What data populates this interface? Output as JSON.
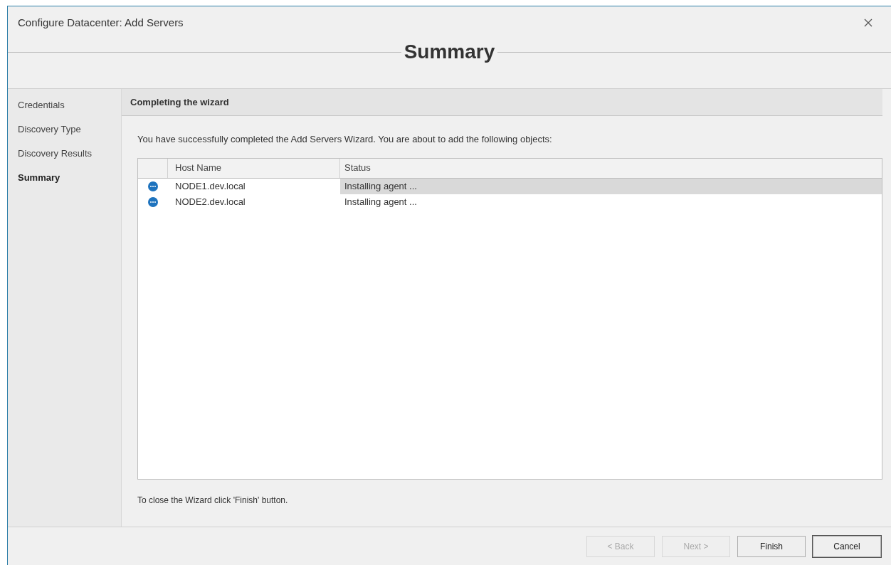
{
  "window": {
    "title": "Configure Datacenter: Add Servers",
    "heading": "Summary"
  },
  "steps": [
    {
      "label": "Credentials",
      "selected": false
    },
    {
      "label": "Discovery Type",
      "selected": false
    },
    {
      "label": "Discovery Results",
      "selected": false
    },
    {
      "label": "Summary",
      "selected": true
    }
  ],
  "panel": {
    "title": "Completing the wizard",
    "intro": "You have successfully completed the Add Servers Wizard. You are about to add the following objects:",
    "footnote": "To close the Wizard click 'Finish' button."
  },
  "table": {
    "columns": [
      "Host Name",
      "Status"
    ],
    "rows": [
      {
        "host": "NODE1.dev.local",
        "status": "Installing agent ...",
        "selected": true
      },
      {
        "host": "NODE2.dev.local",
        "status": "Installing agent ...",
        "selected": false
      }
    ]
  },
  "buttons": [
    {
      "label": "< Back",
      "disabled": true,
      "default": false
    },
    {
      "label": "Next >",
      "disabled": true,
      "default": false
    },
    {
      "label": "Finish",
      "disabled": false,
      "default": false
    },
    {
      "label": "Cancel",
      "disabled": false,
      "default": true
    }
  ]
}
